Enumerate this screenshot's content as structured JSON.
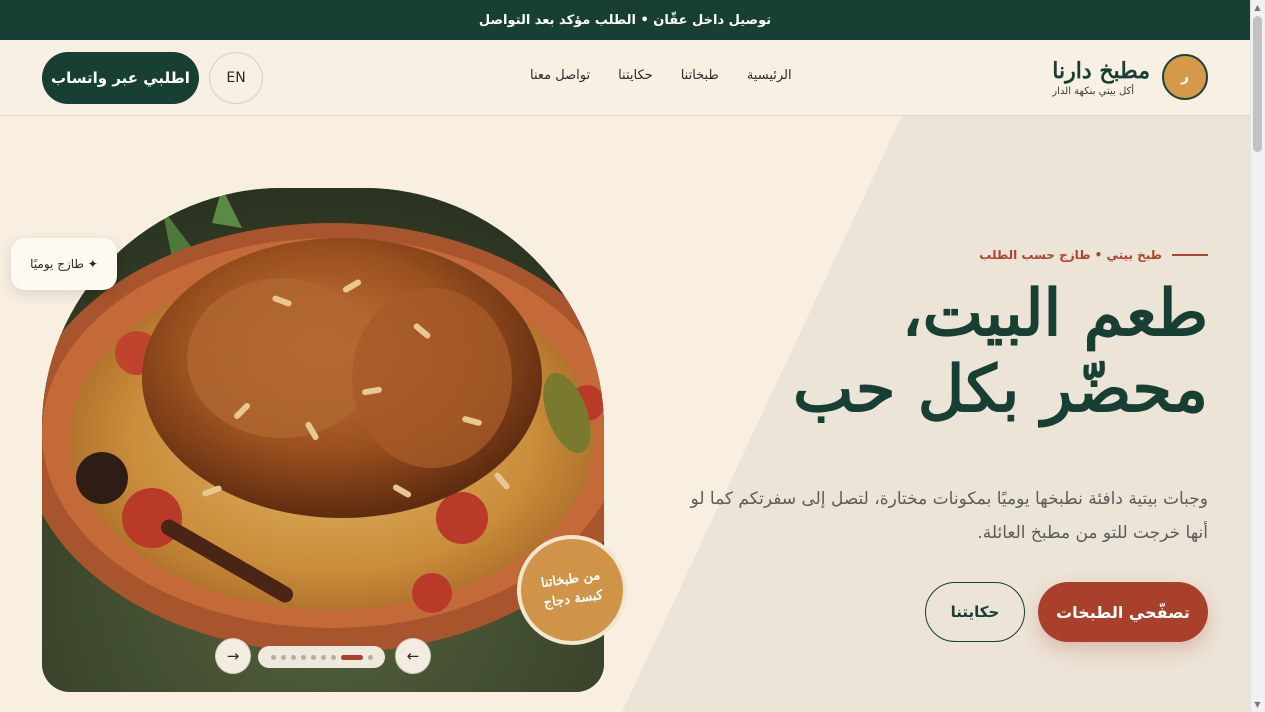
{
  "topbar": {
    "text": "توصيل داخل عقّان • الطلب مؤكد بعد التواصل"
  },
  "brand": {
    "logo_letter": "ر",
    "name": "مطبخ دارنا",
    "tagline": "أكل بيتي بنكهة الدار"
  },
  "nav": {
    "items": [
      {
        "label": "الرئيسية"
      },
      {
        "label": "طبخاتنا"
      },
      {
        "label": "حكايتنا"
      },
      {
        "label": "تواصل معنا"
      }
    ]
  },
  "header_actions": {
    "lang_label": "EN",
    "order_label": "اطلبي عبر واتساب"
  },
  "hero": {
    "eyebrow": "طبخ بيتي • طازج حسب الطلب",
    "headline_line1": "طعم البيت،",
    "headline_line2": "محضّر بكل حب",
    "lead": "وجبات بيتية دافئة نطبخها يوميًا بمكونات مختارة، لتصل إلى سفرتكم كما لو أنها خرجت للتو من مطبخ العائلة.",
    "cta_primary": "تصفّحي الطبخات",
    "cta_secondary": "حكايتنا"
  },
  "gallery": {
    "fresh_badge": "✦ طازج يوميًا",
    "seal_line1": "من طبخاتنا",
    "seal_line2": "كبسة دجاج",
    "next_arrow": "→",
    "prev_arrow": "←",
    "slide_count": 9,
    "active_slide": 2
  },
  "colors": {
    "primary_green": "#173f33",
    "accent_red": "#a8402b",
    "gold": "#cf9447",
    "cream": "#f8efe1"
  }
}
